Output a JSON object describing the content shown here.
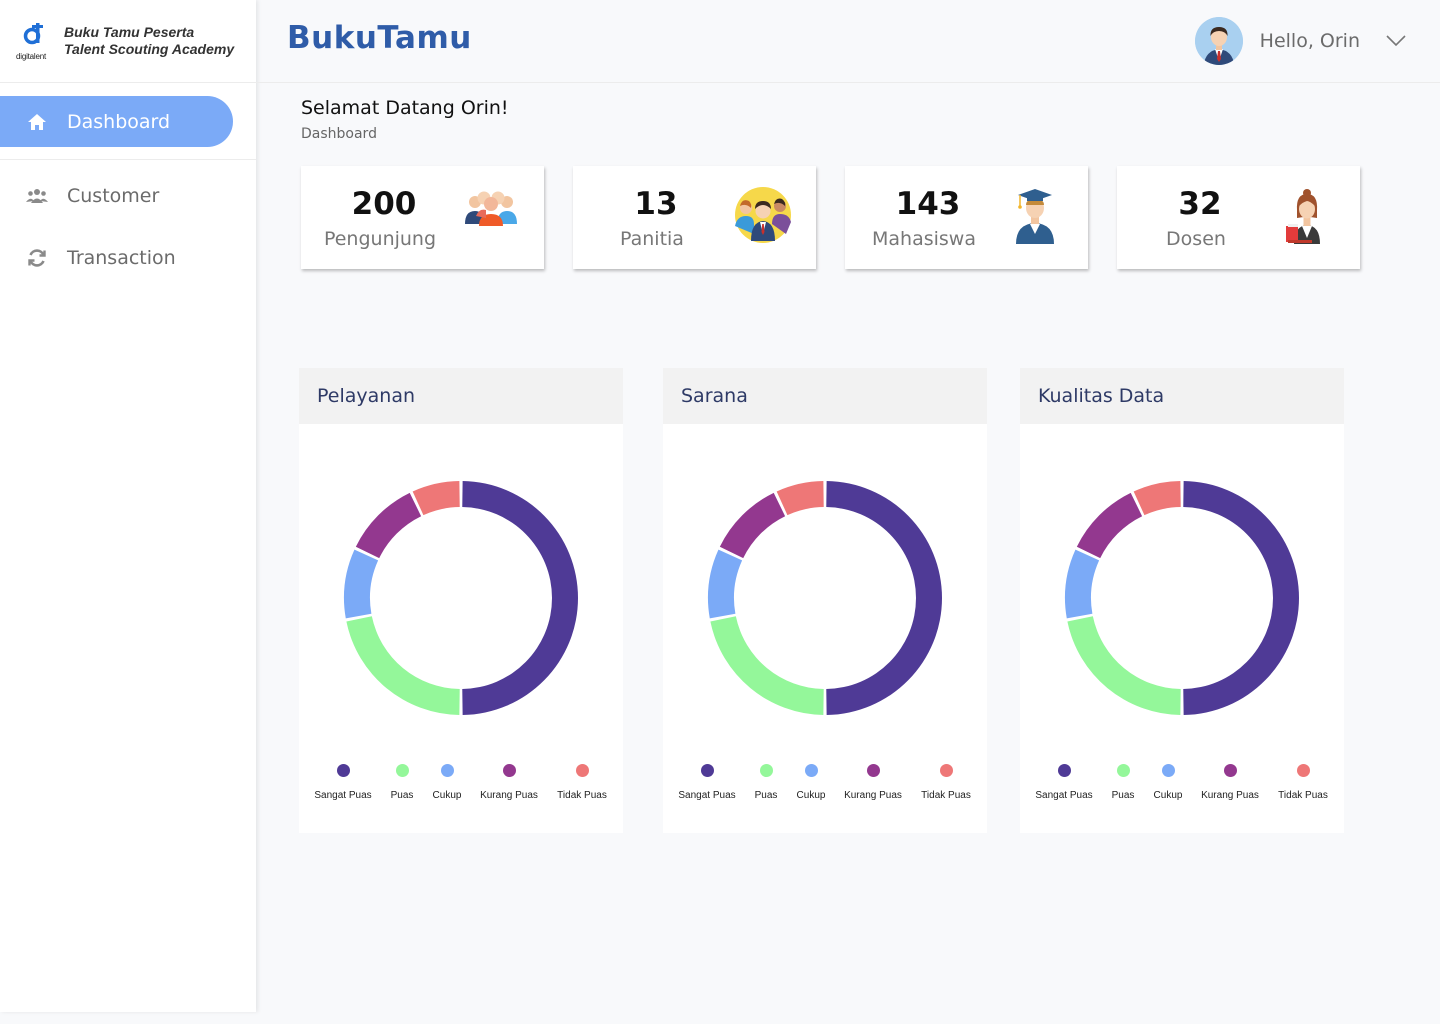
{
  "brand": {
    "logo_word": "digitalent",
    "line1": "Buku Tamu Peserta",
    "line2": "Talent Scouting Academy"
  },
  "sidebar": {
    "items": [
      {
        "label": "Dashboard",
        "icon": "home-icon",
        "active": true
      },
      {
        "label": "Customer",
        "icon": "users-icon",
        "active": false
      },
      {
        "label": "Transaction",
        "icon": "sync-icon",
        "active": false
      }
    ]
  },
  "header": {
    "app_title": "BukuTamu",
    "greeting": "Hello, Orin"
  },
  "main": {
    "welcome": "Selamat Datang Orin!",
    "breadcrumb": "Dashboard",
    "stats": [
      {
        "value": "200",
        "label": "Pengunjung",
        "icon": "group-people-icon"
      },
      {
        "value": "13",
        "label": "Panitia",
        "icon": "committee-icon"
      },
      {
        "value": "143",
        "label": "Mahasiswa",
        "icon": "graduate-student-icon"
      },
      {
        "value": "32",
        "label": "Dosen",
        "icon": "lecturer-icon"
      }
    ]
  },
  "colors": {
    "accent": "#7baaf7",
    "brand_title": "#2f5ca8"
  },
  "chart_data": [
    {
      "type": "pie",
      "variant": "donut",
      "title": "Pelayanan",
      "categories": [
        "Sangat Puas",
        "Puas",
        "Cukup",
        "Kurang Puas",
        "Tidak Puas"
      ],
      "values": [
        50,
        22,
        10,
        11,
        7
      ],
      "colors": [
        "#4f3a96",
        "#94f79a",
        "#7baaf7",
        "#93388f",
        "#ee7777"
      ]
    },
    {
      "type": "pie",
      "variant": "donut",
      "title": "Sarana",
      "categories": [
        "Sangat Puas",
        "Puas",
        "Cukup",
        "Kurang Puas",
        "Tidak Puas"
      ],
      "values": [
        50,
        22,
        10,
        11,
        7
      ],
      "colors": [
        "#4f3a96",
        "#94f79a",
        "#7baaf7",
        "#93388f",
        "#ee7777"
      ]
    },
    {
      "type": "pie",
      "variant": "donut",
      "title": "Kualitas Data",
      "categories": [
        "Sangat Puas",
        "Puas",
        "Cukup",
        "Kurang Puas",
        "Tidak Puas"
      ],
      "values": [
        50,
        22,
        10,
        11,
        7
      ],
      "colors": [
        "#4f3a96",
        "#94f79a",
        "#7baaf7",
        "#93388f",
        "#ee7777"
      ]
    }
  ]
}
